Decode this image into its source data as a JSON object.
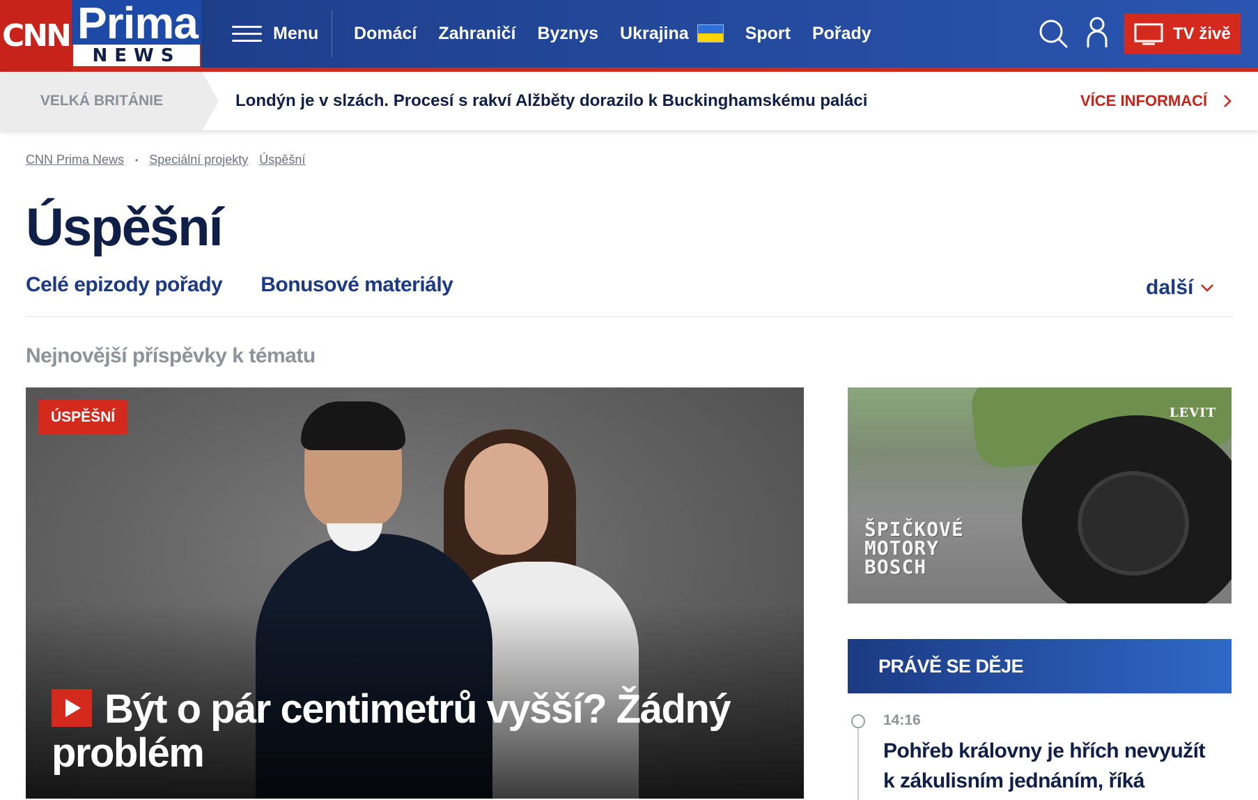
{
  "header": {
    "logo_cnn": "CNN",
    "logo_prima": "Prima",
    "logo_news": "NEWS",
    "menu_label": "Menu",
    "nav": [
      "Domácí",
      "Zahraničí",
      "Byznys",
      "Ukrajina",
      "Sport",
      "Pořady"
    ],
    "tv_label": "TV živě"
  },
  "breaking": {
    "tag": "VELKÁ BRITÁNIE",
    "text": "Londýn je v slzách. Procesí s rakví Alžběty dorazilo k Buckinghamskému paláci",
    "more": "VÍCE INFORMACÍ"
  },
  "breadcrumb": [
    "CNN Prima News",
    "Speciální projekty",
    "Úspěšní"
  ],
  "page": {
    "title": "Úspěšní",
    "subnav": [
      "Celé epizody pořady",
      "Bonusové materiály"
    ],
    "more": "další",
    "section_heading": "Nejnovější příspěvky k tématu"
  },
  "hero": {
    "tag": "ÚSPĚŠNÍ",
    "title": "Být o pár centimetrů vyšší? Žádný problém"
  },
  "ad": {
    "brand": "LEVIT",
    "lines": [
      "ŠPIČKOVÉ",
      "MOTORY",
      "BOSCH"
    ]
  },
  "live": {
    "heading": "PRÁVĚ SE DĚJE",
    "time": "14:16",
    "text": "Pohřeb královny je hřích nevyužít k zákulisním jednáním, říká"
  },
  "colors": {
    "brand_blue": "#1c3a83",
    "accent_red": "#d42a1e"
  }
}
